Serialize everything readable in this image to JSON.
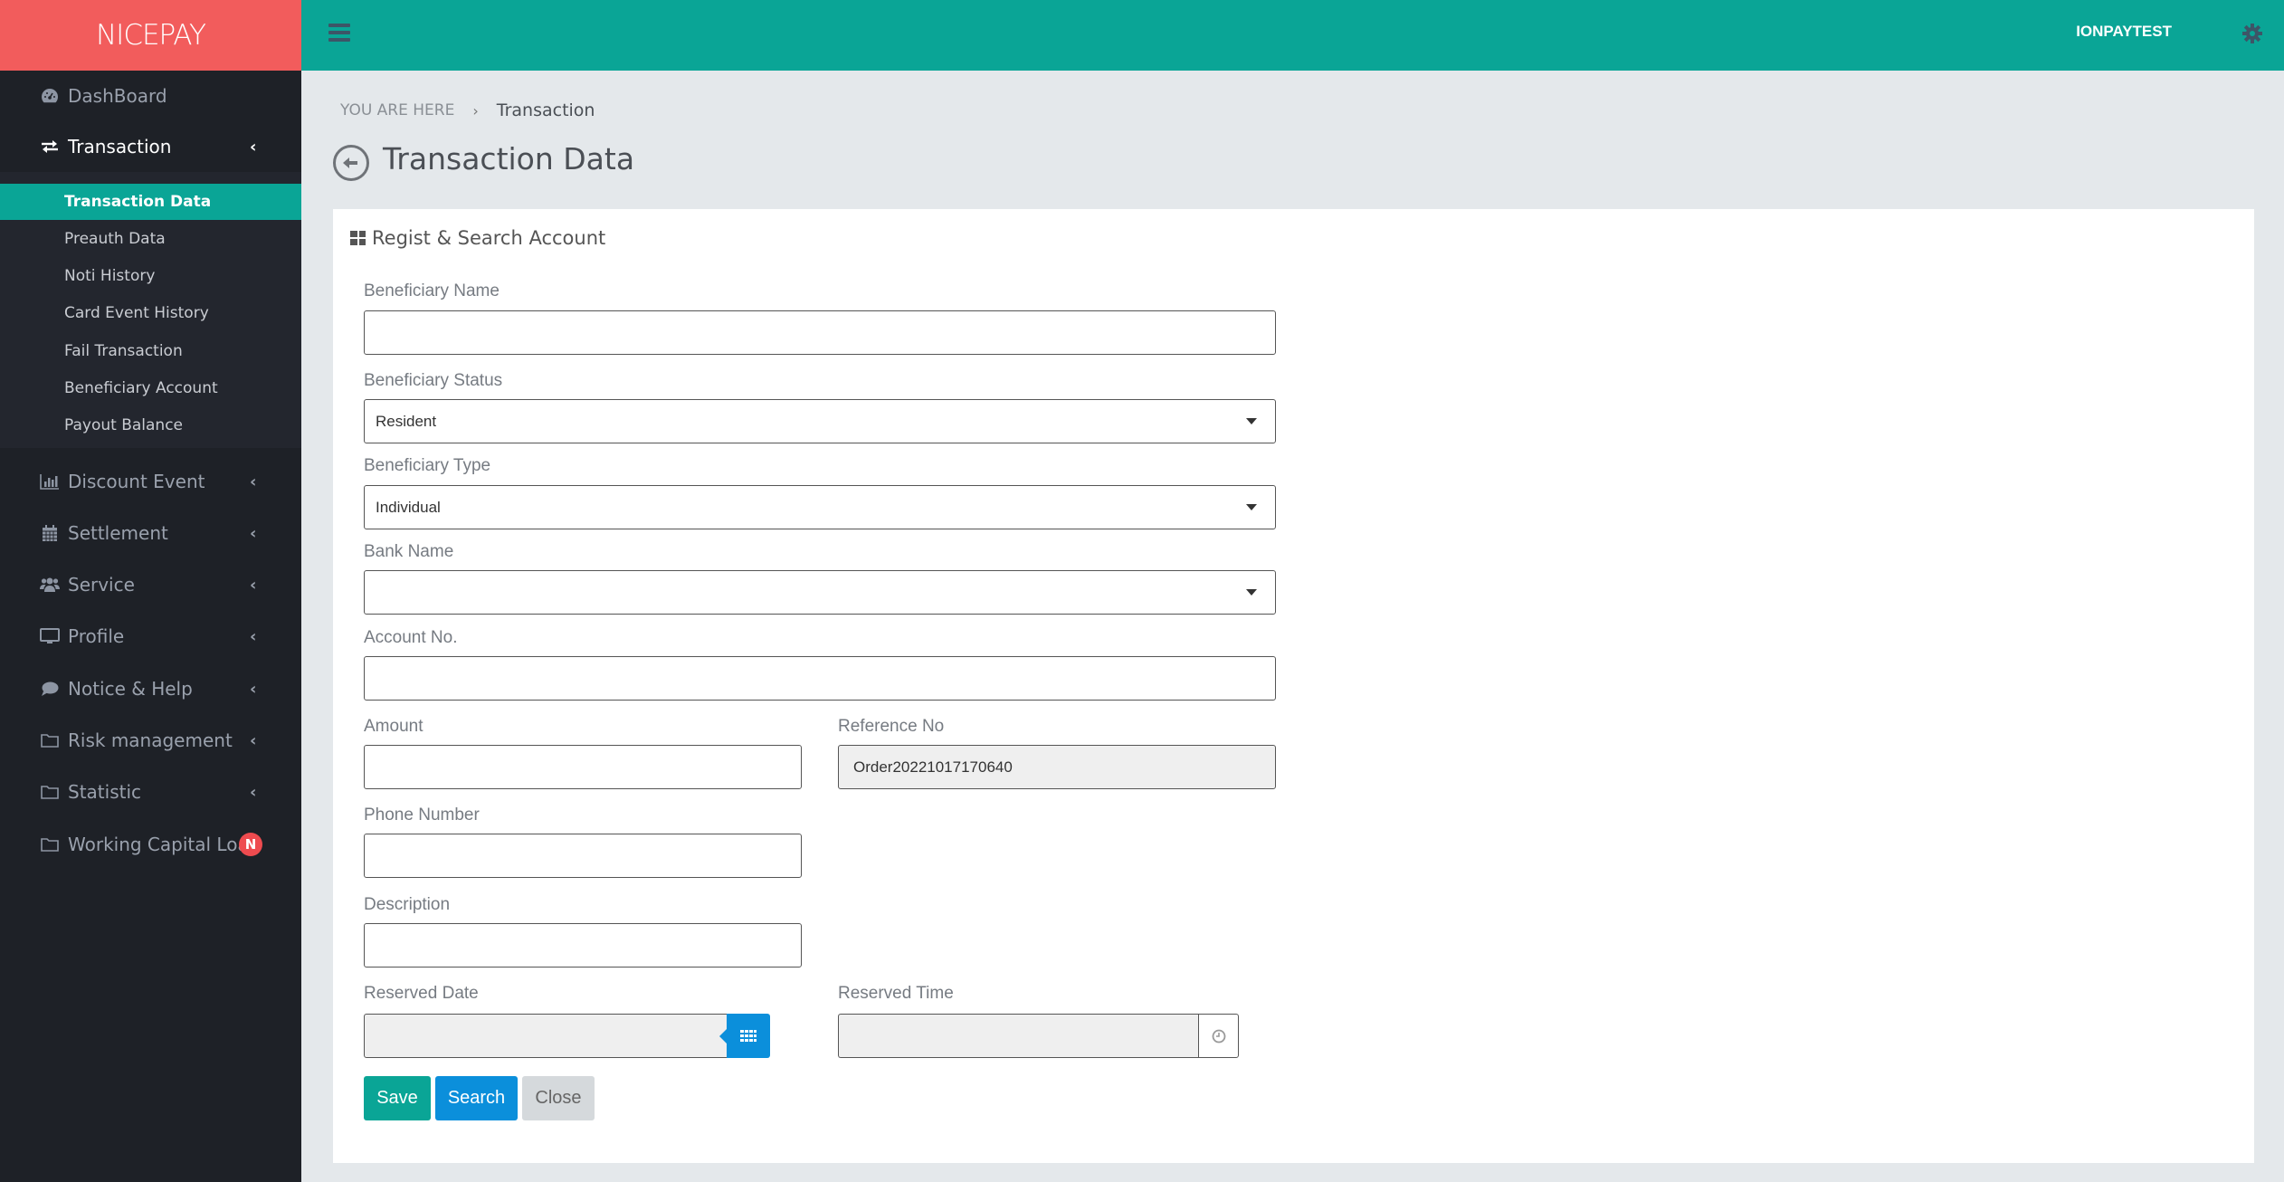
{
  "brand": "NICEPAY",
  "topbar": {
    "user": "IONPAYTEST",
    "menu_icon": "hamburger-icon",
    "settings_icon": "gear-icon"
  },
  "sidebar": {
    "items": [
      {
        "label": "DashBoard",
        "icon": "dashboard-icon"
      },
      {
        "label": "Transaction",
        "icon": "exchange-icon",
        "expanded": true,
        "children": [
          {
            "label": "Transaction Data",
            "active": true
          },
          {
            "label": "Preauth Data"
          },
          {
            "label": "Noti History"
          },
          {
            "label": "Card Event History"
          },
          {
            "label": "Fail Transaction"
          },
          {
            "label": "Beneficiary Account"
          },
          {
            "label": "Payout Balance"
          }
        ]
      },
      {
        "label": "Discount Event",
        "icon": "bar-chart-icon"
      },
      {
        "label": "Settlement",
        "icon": "calendar-icon"
      },
      {
        "label": "Service",
        "icon": "users-icon"
      },
      {
        "label": "Profile",
        "icon": "monitor-icon"
      },
      {
        "label": "Notice & Help",
        "icon": "comment-icon"
      },
      {
        "label": "Risk management",
        "icon": "folder-icon"
      },
      {
        "label": "Statistic",
        "icon": "folder-icon"
      },
      {
        "label": "Working Capital Loan",
        "icon": "folder-icon",
        "badge": "N"
      }
    ]
  },
  "breadcrumb": {
    "prefix": "YOU ARE HERE",
    "separator": "›",
    "current": "Transaction"
  },
  "page": {
    "title": "Transaction Data"
  },
  "card": {
    "title": "Regist & Search Account",
    "fields": {
      "beneficiary_name": {
        "label": "Beneficiary Name",
        "value": ""
      },
      "beneficiary_status": {
        "label": "Beneficiary Status",
        "value": "Resident"
      },
      "beneficiary_type": {
        "label": "Beneficiary Type",
        "value": "Individual"
      },
      "bank_name": {
        "label": "Bank Name",
        "value": ""
      },
      "account_no": {
        "label": "Account No.",
        "value": ""
      },
      "amount": {
        "label": "Amount",
        "value": ""
      },
      "reference_no": {
        "label": "Reference No",
        "value": "Order20221017170640"
      },
      "phone_number": {
        "label": "Phone Number",
        "value": ""
      },
      "description": {
        "label": "Description",
        "value": ""
      },
      "reserved_date": {
        "label": "Reserved Date",
        "value": ""
      },
      "reserved_time": {
        "label": "Reserved Time",
        "value": ""
      }
    },
    "buttons": {
      "save": "Save",
      "search": "Search",
      "close": "Close"
    }
  },
  "colors": {
    "brand": "#f25c5c",
    "accent": "#0aa596",
    "primary": "#0b8fdb",
    "sidebar_bg": "#1e2127",
    "badge": "#ee4b4f"
  }
}
